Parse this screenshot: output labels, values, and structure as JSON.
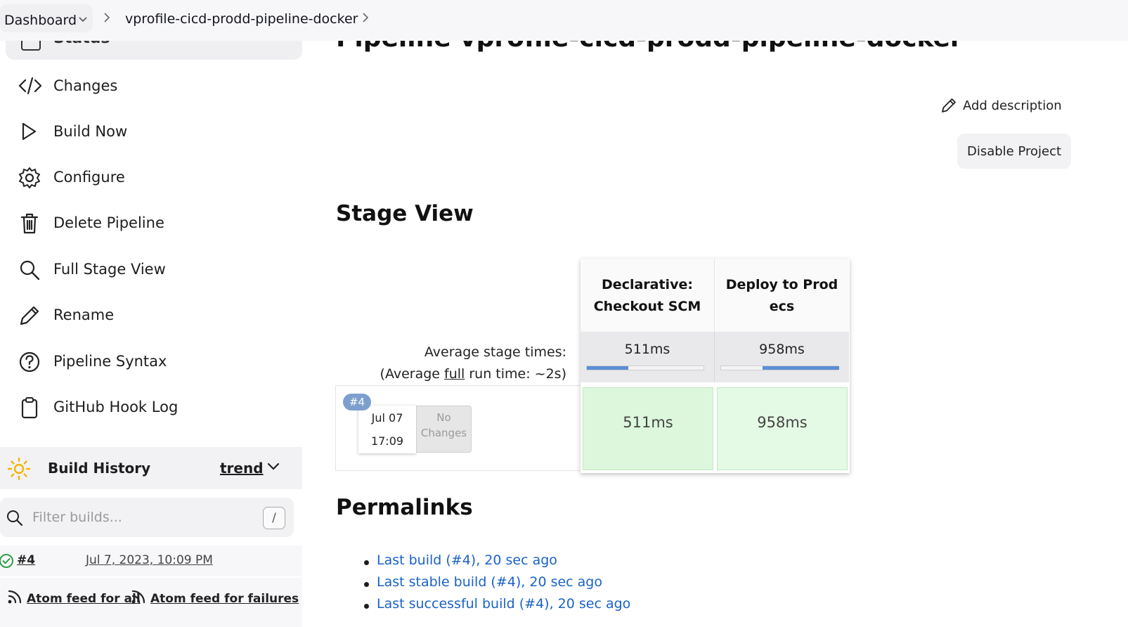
{
  "breadcrumb": {
    "dashboard": "Dashboard",
    "job": "vprofile-cicd-prodd-pipeline-docker"
  },
  "sidebar": {
    "status_label": "Status",
    "items": [
      {
        "label": "Changes",
        "icon": "code-icon"
      },
      {
        "label": "Build Now",
        "icon": "play-icon"
      },
      {
        "label": "Configure",
        "icon": "gear-icon"
      },
      {
        "label": "Delete Pipeline",
        "icon": "trash-icon"
      },
      {
        "label": "Full Stage View",
        "icon": "search-icon"
      },
      {
        "label": "Rename",
        "icon": "pencil-icon"
      },
      {
        "label": "Pipeline Syntax",
        "icon": "help-icon"
      },
      {
        "label": "GitHub Hook Log",
        "icon": "clipboard-icon"
      }
    ],
    "build_history": {
      "title": "Build History",
      "trend": "trend",
      "filter_placeholder": "Filter builds...",
      "filter_shortcut": "/",
      "builds": [
        {
          "number": "#4",
          "date": "Jul 7, 2023, 10:09 PM",
          "status": "success"
        }
      ],
      "feed_all": "Atom feed for all",
      "feed_failures": "Atom feed for failures"
    }
  },
  "main": {
    "title": "Pipeline vprofile-cicd-prodd-pipeline-docker",
    "add_description": "Add description",
    "disable_project": "Disable Project",
    "stage_view": {
      "heading": "Stage View",
      "avg_label": "Average stage times:",
      "avg_run_prefix": "(Average ",
      "avg_run_link": "full",
      "avg_run_suffix": " run time: ~2s)",
      "stages": [
        {
          "name_line1": "Declarative:",
          "name_line2": "Checkout SCM",
          "avg": "511ms",
          "bar_fraction": 0.35
        },
        {
          "name_line1": "Deploy to Prod",
          "name_line2": "ecs",
          "avg": "958ms",
          "bar_fraction": 0.65
        }
      ],
      "runs": [
        {
          "badge": "#4",
          "date": "Jul 07",
          "time": "17:09",
          "changes_line1": "No",
          "changes_line2": "Changes",
          "durations": [
            "511ms",
            "958ms"
          ]
        }
      ]
    },
    "permalinks": {
      "heading": "Permalinks",
      "links": [
        "Last build (#4), 20 sec ago",
        "Last stable build (#4), 20 sec ago",
        "Last successful build (#4), 20 sec ago"
      ]
    }
  },
  "colors": {
    "link": "#1a62c6",
    "stage_success": "#dcf7dc",
    "bar_fill": "#5b8dd6",
    "run_badge": "#7d9fce",
    "success_check": "#2e9e4a",
    "sun": "#f5b400"
  }
}
